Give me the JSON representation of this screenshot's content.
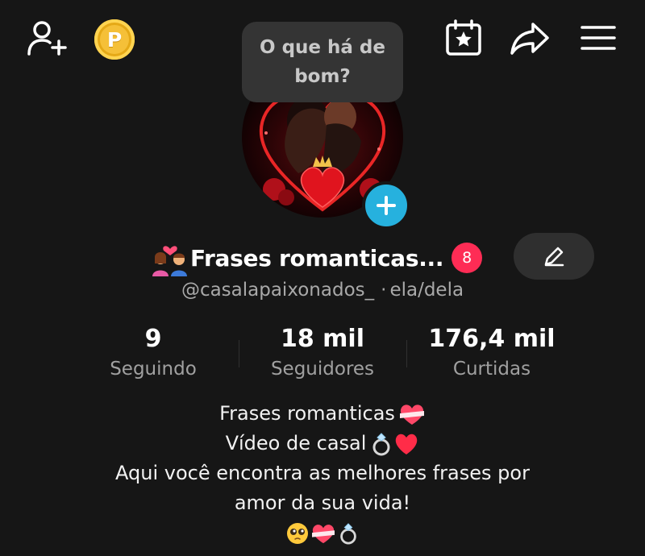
{
  "top_bar": {
    "add_friend_icon": "person-plus-icon",
    "coin_icon": "coin-icon",
    "coin_letter": "P",
    "calendar_icon": "calendar-star-icon",
    "share_icon": "share-arrow-icon",
    "menu_icon": "hamburger-menu-icon"
  },
  "tooltip": {
    "text": "O que há de bom?"
  },
  "profile": {
    "avatar_add_icon": "plus-icon",
    "name_emoji": "couple-with-heart-emoji",
    "display_name": "Frases romanticas...",
    "notification_count": "8",
    "edit_icon": "pencil-icon",
    "handle": "@casalapaixonados_",
    "separator": "·",
    "pronouns": "ela/dela"
  },
  "stats": [
    {
      "value": "9",
      "label": "Seguindo"
    },
    {
      "value": "18 mil",
      "label": "Seguidores"
    },
    {
      "value": "176,4 mil",
      "label": "Curtidas"
    }
  ],
  "bio": {
    "line1": "Frases romanticas",
    "line2": "Vídeo de casal",
    "line3": "Aqui você encontra as melhores frases por",
    "line4": "amor da sua vida!",
    "emojis": [
      "heart-with-ribbon-emoji",
      "ring-emoji",
      "red-heart-emoji",
      "pleading-face-emoji"
    ]
  },
  "colors": {
    "background": "#161616",
    "badge": "#fe2c55",
    "avatar_plus": "#26b1de",
    "coin": "#f5c038",
    "secondary_text": "#a0a0a0"
  }
}
